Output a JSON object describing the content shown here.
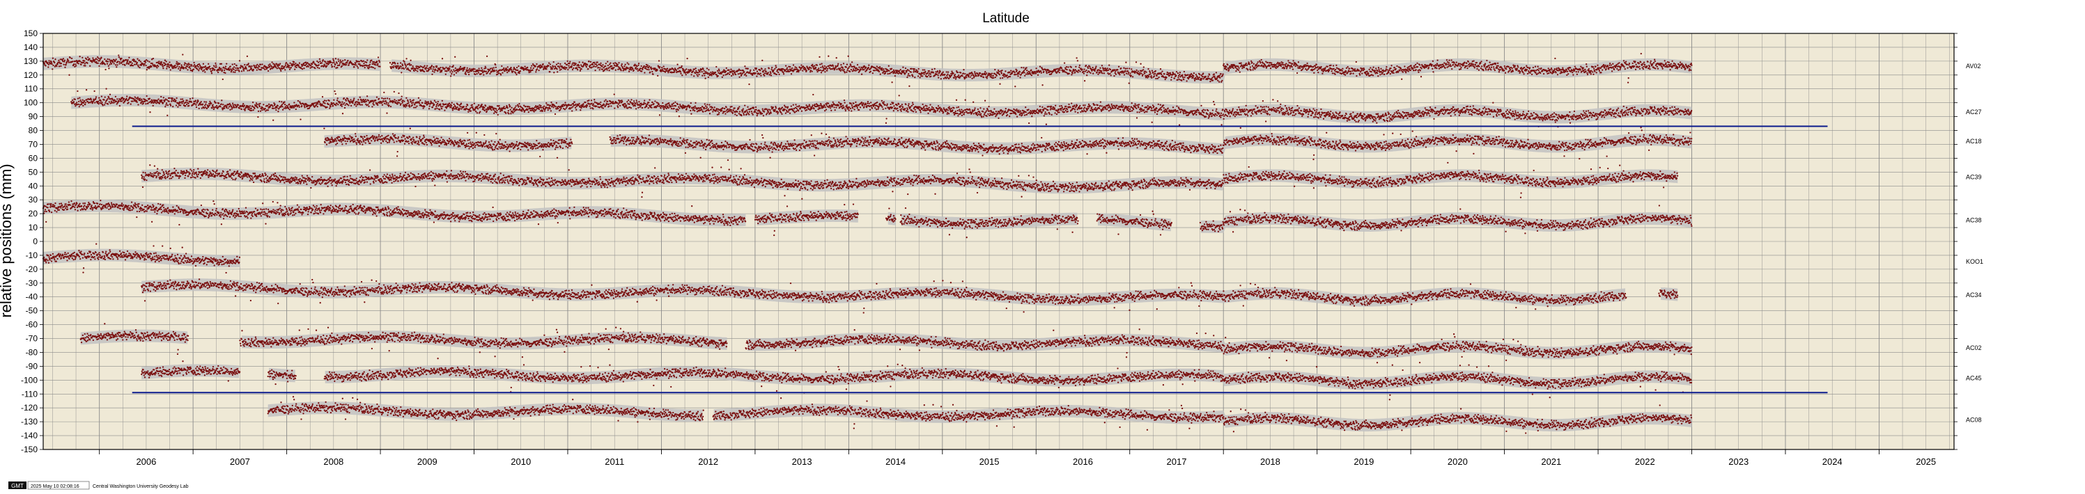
{
  "chart_data": {
    "type": "scatter",
    "title": "Latitude",
    "ylabel": "relative positions (mm)",
    "xlabel": "",
    "x_ticks": [
      "2006",
      "2007",
      "2008",
      "2009",
      "2010",
      "2011",
      "2012",
      "2013",
      "2014",
      "2015",
      "2016",
      "2017",
      "2018",
      "2019",
      "2020",
      "2021",
      "2022",
      "2023",
      "2024",
      "2025"
    ],
    "xlim": [
      2005.4,
      2025.8
    ],
    "ylim": [
      -150,
      150
    ],
    "y_tick_step": 10,
    "grid": true,
    "series": [
      {
        "name": "AV02",
        "start": 2005.4,
        "end": 2023.0,
        "base": 128,
        "trend": -0.6,
        "step2018": 6,
        "level_after": 125,
        "gaps": [
          [
            2009.0,
            2009.1
          ]
        ]
      },
      {
        "name": "AC27",
        "start": 2005.7,
        "end": 2023.0,
        "base": 100,
        "trend": -0.5,
        "step2018": 10,
        "level_after": 92,
        "gaps": []
      },
      {
        "name": "AC18",
        "start": 2008.4,
        "end": 2023.0,
        "base": 72,
        "trend": -0.4,
        "step2018": 8,
        "level_after": 71,
        "gaps": [
          [
            2011.05,
            2011.45
          ]
        ]
      },
      {
        "name": "AC39",
        "start": 2006.45,
        "end": 2022.85,
        "base": 47,
        "trend": -0.6,
        "step2018": 8,
        "level_after": 45,
        "gaps": []
      },
      {
        "name": "AC38",
        "start": 2005.4,
        "end": 2023.0,
        "base": 24,
        "trend": -0.9,
        "step2018": 13,
        "level_after": 14,
        "gaps": [
          [
            2012.9,
            2013.0
          ],
          [
            2014.1,
            2014.4
          ],
          [
            2014.5,
            2014.55
          ],
          [
            2016.45,
            2016.65
          ],
          [
            2017.45,
            2017.75
          ]
        ]
      },
      {
        "name": "KOO1",
        "start": 2005.4,
        "end": 2007.5,
        "base": -12,
        "trend": 0.0,
        "step2018": 0,
        "level_after": -12,
        "gaps": []
      },
      {
        "name": "AC34",
        "start": 2006.45,
        "end": 2022.85,
        "base": -33,
        "trend": -0.7,
        "step2018": 12,
        "level_after": -40,
        "gaps": [
          [
            2022.3,
            2022.65
          ]
        ]
      },
      {
        "name": "AC02",
        "start": 2005.8,
        "end": 2023.0,
        "base": -70,
        "trend": -0.3,
        "step2018": 8,
        "level_after": -78,
        "gaps": [
          [
            2006.95,
            2007.5
          ],
          [
            2012.7,
            2012.9
          ]
        ]
      },
      {
        "name": "AC45",
        "start": 2006.45,
        "end": 2023.0,
        "base": -95,
        "trend": -0.3,
        "step2018": 6,
        "level_after": -100,
        "gaps": [
          [
            2007.5,
            2007.8
          ],
          [
            2008.1,
            2008.4
          ]
        ]
      },
      {
        "name": "AC08",
        "start": 2007.8,
        "end": 2023.0,
        "base": -122,
        "trend": -0.3,
        "step2018": 4,
        "level_after": -130,
        "gaps": [
          [
            2012.45,
            2012.55
          ]
        ]
      }
    ],
    "reference_lines": [
      {
        "y": 83,
        "x_start": 2006.35,
        "x_end": 2024.45,
        "color": "#0b1a8c"
      },
      {
        "y": -109,
        "x_start": 2006.35,
        "x_end": 2024.45,
        "color": "#0b1a8c"
      }
    ],
    "colors": {
      "background": "#efe9d6",
      "points": "#7a0f0f",
      "band": "#c2c2c2",
      "grid": "#8a8a8a",
      "reference_line": "#0b1a8c"
    }
  },
  "footer": {
    "logo": "GMT",
    "timestamp": "2025 May 10 02:08:16",
    "credit": "Central Washington University Geodesy Lab"
  }
}
